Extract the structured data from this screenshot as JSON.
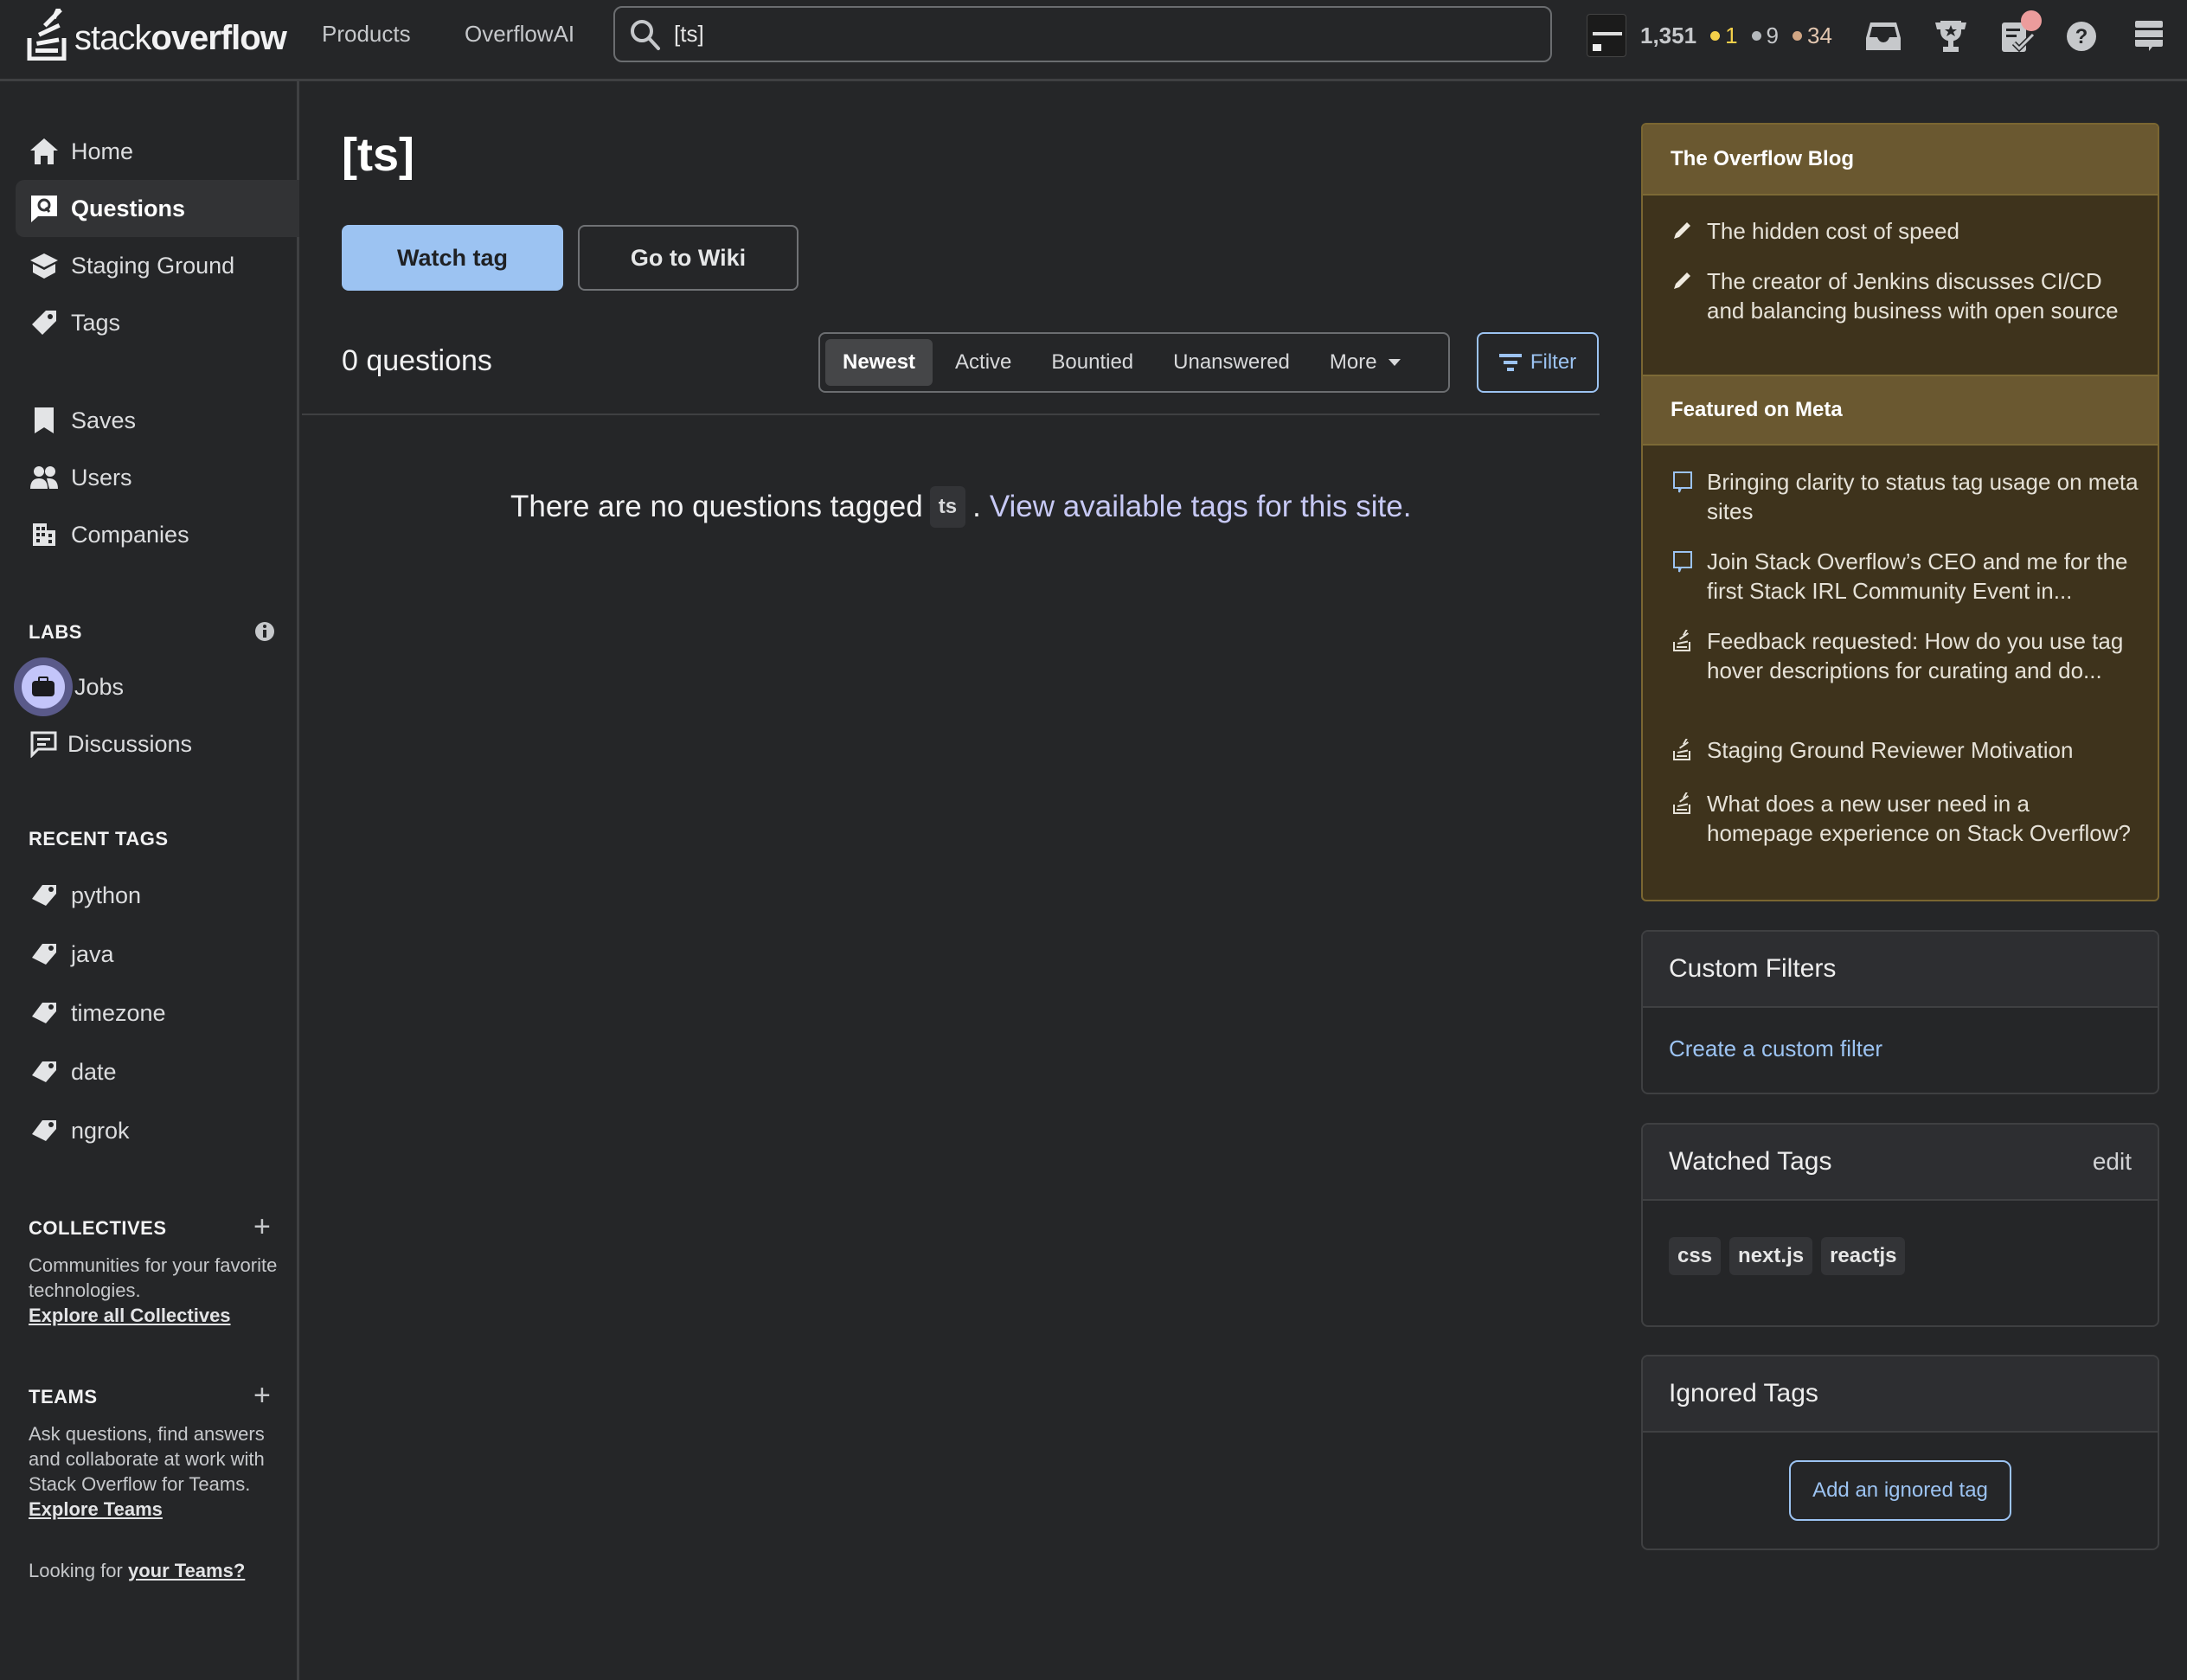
{
  "header": {
    "logo_light": "stack",
    "logo_bold": "overflow",
    "nav": [
      "Products",
      "OverflowAI"
    ],
    "search_value": "[ts]",
    "reputation": "1,351",
    "badges": {
      "gold": {
        "count": "1",
        "color": "#f5d04a"
      },
      "silver": {
        "count": "9",
        "color": "#b4b8bc"
      },
      "bronze": {
        "count": "34",
        "color": "#d1a684"
      }
    },
    "icons": [
      "inbox-icon",
      "trophy-icon",
      "review-queue-icon",
      "help-icon",
      "site-switcher-icon"
    ]
  },
  "sidebar": {
    "primary": [
      {
        "label": "Home",
        "icon": "home-icon"
      },
      {
        "label": "Questions",
        "icon": "questions-icon",
        "active": true
      },
      {
        "label": "Staging Ground",
        "icon": "staging-ground-icon"
      },
      {
        "label": "Tags",
        "icon": "tag-icon"
      }
    ],
    "secondary": [
      {
        "label": "Saves",
        "icon": "bookmark-icon"
      },
      {
        "label": "Users",
        "icon": "users-icon"
      },
      {
        "label": "Companies",
        "icon": "building-icon"
      }
    ],
    "labs": {
      "title": "LABS",
      "items": [
        {
          "label": "Jobs",
          "icon": "briefcase-icon"
        },
        {
          "label": "Discussions",
          "icon": "discussion-icon"
        }
      ]
    },
    "recent_tags": {
      "title": "RECENT TAGS",
      "items": [
        "python",
        "java",
        "timezone",
        "date",
        "ngrok"
      ]
    },
    "collectives": {
      "title": "COLLECTIVES",
      "text": "Communities for your favorite technologies.",
      "link": "Explore all Collectives"
    },
    "teams": {
      "title": "TEAMS",
      "text": "Ask questions, find answers and collaborate at work with Stack Overflow for Teams.",
      "link": "Explore Teams",
      "looking_prefix": "Looking for",
      "looking_link": "your Teams?"
    }
  },
  "main": {
    "title": "[ts]",
    "watch_tag": "Watch tag",
    "go_to_wiki": "Go to Wiki",
    "question_count": "0 questions",
    "sort_tabs": [
      "Newest",
      "Active",
      "Bountied",
      "Unanswered",
      "More"
    ],
    "active_sort": "Newest",
    "filter_label": "Filter",
    "empty": {
      "prefix": "There are no questions tagged",
      "tag": "ts",
      "separator": ".",
      "link": "View available tags for this site."
    }
  },
  "right": {
    "blog": {
      "title": "The Overflow Blog",
      "items": [
        "The hidden cost of speed",
        "The creator of Jenkins discusses CI/CD and balancing business with open source"
      ]
    },
    "meta": {
      "title": "Featured on Meta",
      "items": [
        {
          "text": "Bringing clarity to status tag usage on meta sites",
          "icon": "meta-chat-icon"
        },
        {
          "text": "Join Stack Overflow’s CEO and me for the first Stack IRL Community Event in...",
          "icon": "meta-chat-icon"
        },
        {
          "text": "Feedback requested: How do you use tag hover descriptions for curating and do...",
          "icon": "stackoverflow-icon"
        },
        {
          "text": "Staging Ground Reviewer Motivation",
          "icon": "stackoverflow-icon"
        },
        {
          "text": "What does a new user need in a homepage experience on Stack Overflow?",
          "icon": "stackoverflow-icon"
        }
      ]
    },
    "custom_filters": {
      "title": "Custom Filters",
      "link": "Create a custom filter"
    },
    "watched_tags": {
      "title": "Watched Tags",
      "edit": "edit",
      "tags": [
        "css",
        "next.js",
        "reactjs"
      ]
    },
    "ignored_tags": {
      "title": "Ignored Tags",
      "button": "Add an ignored tag"
    }
  }
}
